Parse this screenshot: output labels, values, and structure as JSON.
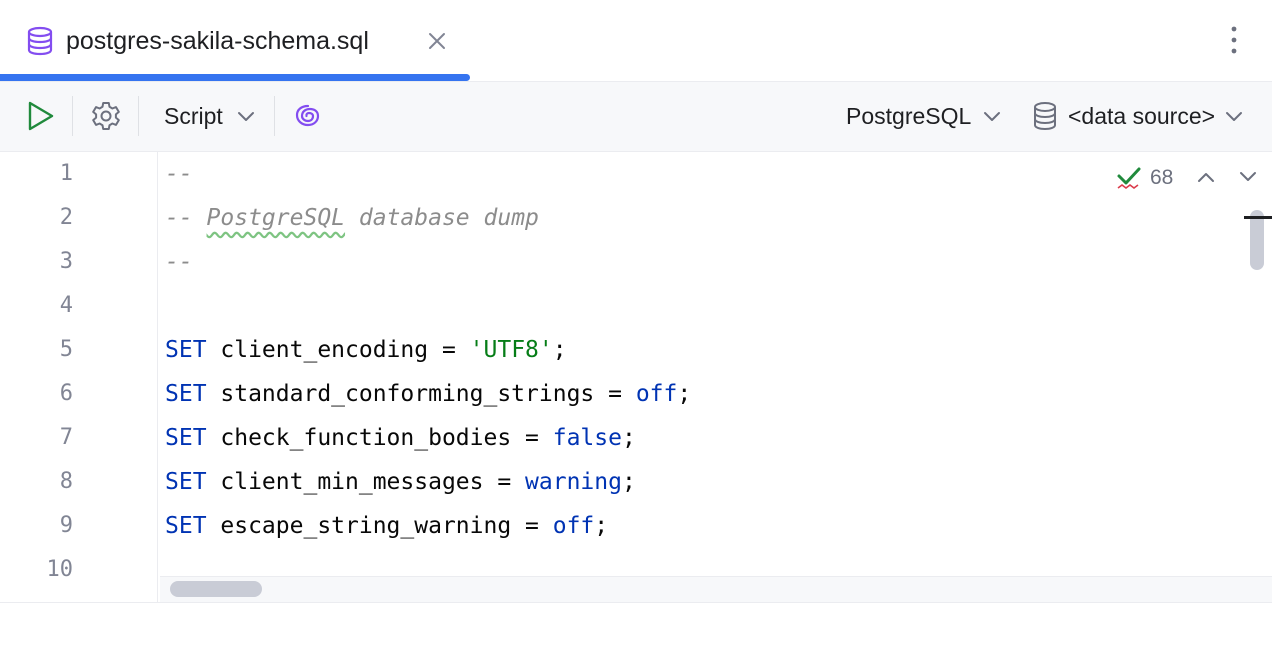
{
  "tab": {
    "title": "postgres-sakila-schema.sql",
    "icon": "database-icon",
    "active": true
  },
  "toolbar": {
    "run_icon": "play-icon",
    "settings_icon": "gear-icon",
    "script_label": "Script",
    "ai_icon": "ai-assistant-icon",
    "dialect_label": "PostgreSQL",
    "datasource_label": "<data source>"
  },
  "editor": {
    "line_numbers": [
      "1",
      "2",
      "3",
      "4",
      "5",
      "6",
      "7",
      "8",
      "9",
      "10"
    ],
    "inspection_count": "68",
    "lines": [
      {
        "tokens": [
          {
            "t": "--",
            "c": "cmt"
          }
        ]
      },
      {
        "tokens": [
          {
            "t": "-- ",
            "c": "cmt"
          },
          {
            "t": "PostgreSQL",
            "c": "cmt typo"
          },
          {
            "t": " database dump",
            "c": "cmt"
          }
        ]
      },
      {
        "tokens": [
          {
            "t": "--",
            "c": "cmt"
          }
        ]
      },
      {
        "tokens": []
      },
      {
        "tokens": [
          {
            "t": "SET",
            "c": "kw"
          },
          {
            "t": " client_encoding = ",
            "c": ""
          },
          {
            "t": "'UTF8'",
            "c": "str"
          },
          {
            "t": ";",
            "c": ""
          }
        ]
      },
      {
        "tokens": [
          {
            "t": "SET",
            "c": "kw"
          },
          {
            "t": " standard_conforming_strings = ",
            "c": ""
          },
          {
            "t": "off",
            "c": "kw"
          },
          {
            "t": ";",
            "c": ""
          }
        ]
      },
      {
        "tokens": [
          {
            "t": "SET",
            "c": "kw"
          },
          {
            "t": " check_function_bodies = ",
            "c": ""
          },
          {
            "t": "false",
            "c": "kw"
          },
          {
            "t": ";",
            "c": ""
          }
        ]
      },
      {
        "tokens": [
          {
            "t": "SET",
            "c": "kw"
          },
          {
            "t": " client_min_messages = ",
            "c": ""
          },
          {
            "t": "warning",
            "c": "kw"
          },
          {
            "t": ";",
            "c": ""
          }
        ]
      },
      {
        "tokens": [
          {
            "t": "SET",
            "c": "kw"
          },
          {
            "t": " escape_string_warning = ",
            "c": ""
          },
          {
            "t": "off",
            "c": "kw"
          },
          {
            "t": ";",
            "c": ""
          }
        ]
      },
      {
        "tokens": []
      }
    ]
  },
  "colors": {
    "accent": "#3574f0",
    "keyword": "#0033b3",
    "string": "#067d17",
    "comment": "#8c8c8c",
    "run": "#208a3c",
    "ai": "#834df0"
  }
}
